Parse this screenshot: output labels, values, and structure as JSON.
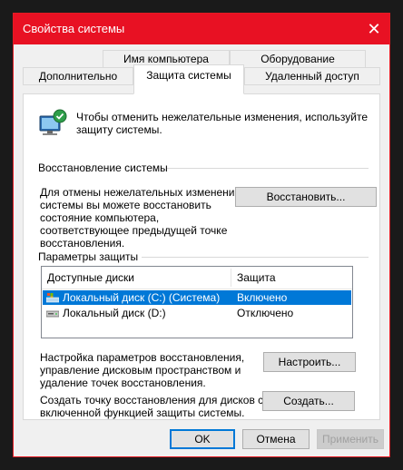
{
  "window": {
    "title": "Свойства системы",
    "close_glyph": "✕"
  },
  "tabs": {
    "row1": [
      "Имя компьютера",
      "Оборудование"
    ],
    "row2": [
      "Дополнительно",
      "Защита системы",
      "Удаленный доступ"
    ],
    "active": "Защита системы"
  },
  "intro": {
    "text_line1": "Чтобы отменить нежелательные изменения, используйте",
    "text_line2": "защиту системы.",
    "icon": "computer-shield-icon"
  },
  "restore": {
    "group_label": "Восстановление системы",
    "desc_lines": [
      "Для отмены нежелательных изменений",
      "системы вы можете восстановить",
      "состояние компьютера,",
      "соответствующее предыдущей точке",
      "восстановления."
    ],
    "button_label": "Восстановить..."
  },
  "protection": {
    "group_label": "Параметры защиты",
    "columns": [
      "Доступные диски",
      "Защита"
    ],
    "rows": [
      {
        "disk": "Локальный диск (C:) (Система)",
        "status": "Включено",
        "selected": true,
        "icon": "system-drive-icon"
      },
      {
        "disk": "Локальный диск (D:)",
        "status": "Отключено",
        "selected": false,
        "icon": "drive-icon"
      }
    ]
  },
  "configure": {
    "desc_lines": [
      "Настройка параметров восстановления,",
      "управление дисковым пространством и",
      "удаление точек восстановления."
    ],
    "button_label": "Настроить..."
  },
  "create": {
    "desc_lines": [
      "Создать точку восстановления для дисков с",
      "включенной функцией защиты системы."
    ],
    "button_label": "Создать..."
  },
  "footer": {
    "ok_label": "OK",
    "cancel_label": "Отмена",
    "apply_label": "Применить"
  },
  "colors": {
    "titlebar": "#e81123",
    "selection": "#0078d7",
    "default_button_border": "#0078d7"
  }
}
